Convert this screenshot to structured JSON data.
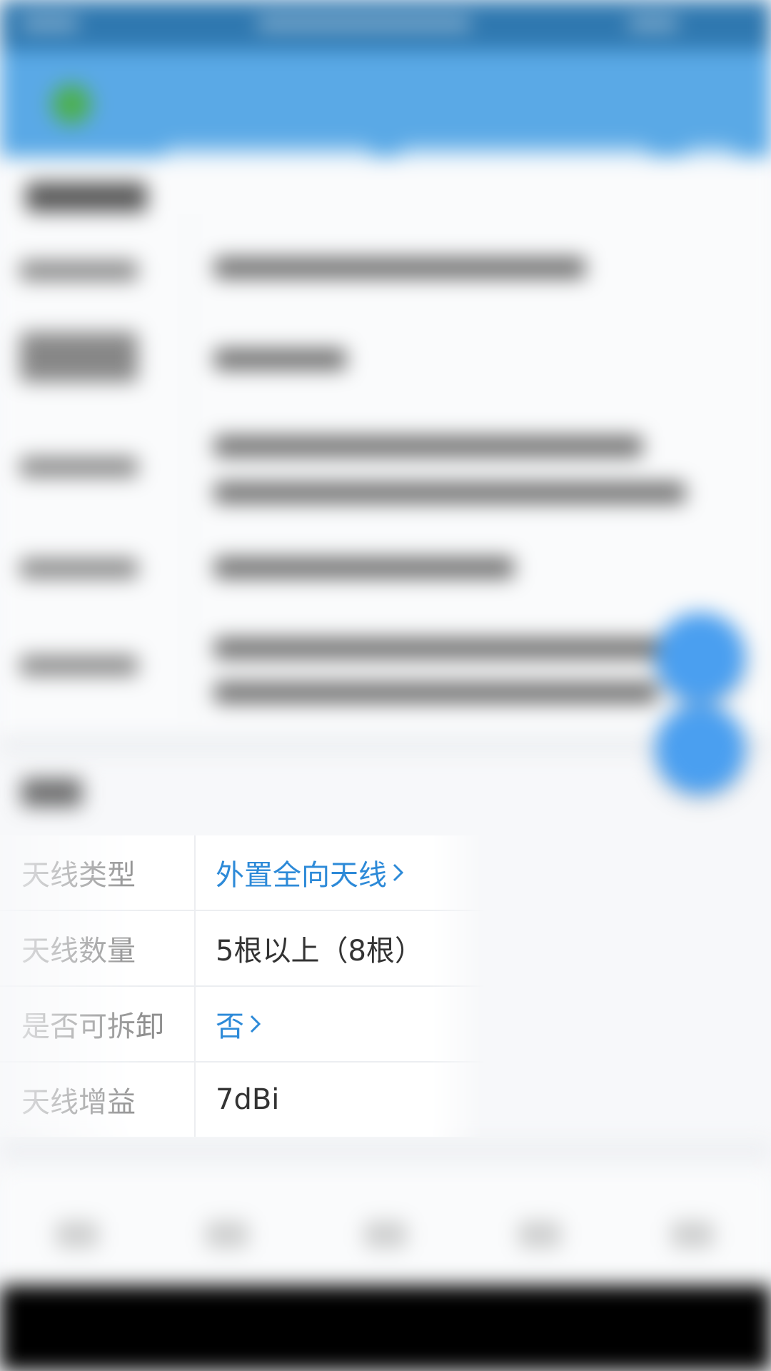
{
  "colors": {
    "appbar": "#5aa9e6",
    "link": "#2d8ad8",
    "fab": "#4a9ff0",
    "label": "#8f8f8f",
    "value": "#333333"
  },
  "antenna_section": {
    "rows": [
      {
        "label": "天线类型",
        "value": "外置全向天线",
        "is_link": true,
        "icon": "chevron-right-icon"
      },
      {
        "label": "天线数量",
        "value": "5根以上（8根）",
        "is_link": false
      },
      {
        "label": "是否可拆卸",
        "value": "否",
        "is_link": true,
        "icon": "chevron-right-icon"
      },
      {
        "label": "天线增益",
        "value": "7dBi",
        "is_link": false
      }
    ]
  },
  "floating_buttons": [
    "fab-primary",
    "fab-secondary"
  ]
}
